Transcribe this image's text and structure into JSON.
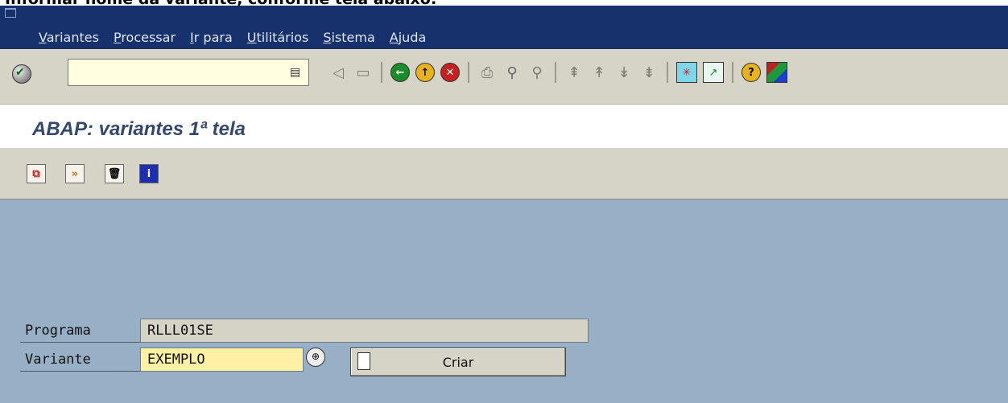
{
  "caption": "Informar nome da variante, conforme tela abaixo:",
  "menu": [
    "Variantes",
    "Processar",
    "Ir para",
    "Utilitários",
    "Sistema",
    "Ajuda"
  ],
  "title": "ABAP: variantes 1ª tela",
  "form": {
    "programa_label": "Programa",
    "programa_value": "RLLL01SE",
    "variante_label": "Variante",
    "variante_value": "EXEMPLO",
    "criar_label": "Criar"
  },
  "colors": {
    "menubar": "#16316b",
    "toolbar": "#d6d3c7",
    "body": "#97b0c5",
    "input_bg": "#fff1a4"
  },
  "icons": {
    "toolbar": [
      "enter-check-icon",
      "command-field",
      "back-arrow-icon",
      "save-icon",
      "back-icon",
      "exit-icon",
      "cancel-icon",
      "print-icon",
      "find-icon",
      "find-next-icon",
      "first-page-icon",
      "prev-page-icon",
      "next-page-icon",
      "last-page-icon",
      "create-session-icon",
      "shortcut-icon",
      "help-icon",
      "layout-icon"
    ],
    "app_toolbar": [
      "copy-icon",
      "display-icon",
      "delete-icon",
      "info-icon"
    ]
  }
}
